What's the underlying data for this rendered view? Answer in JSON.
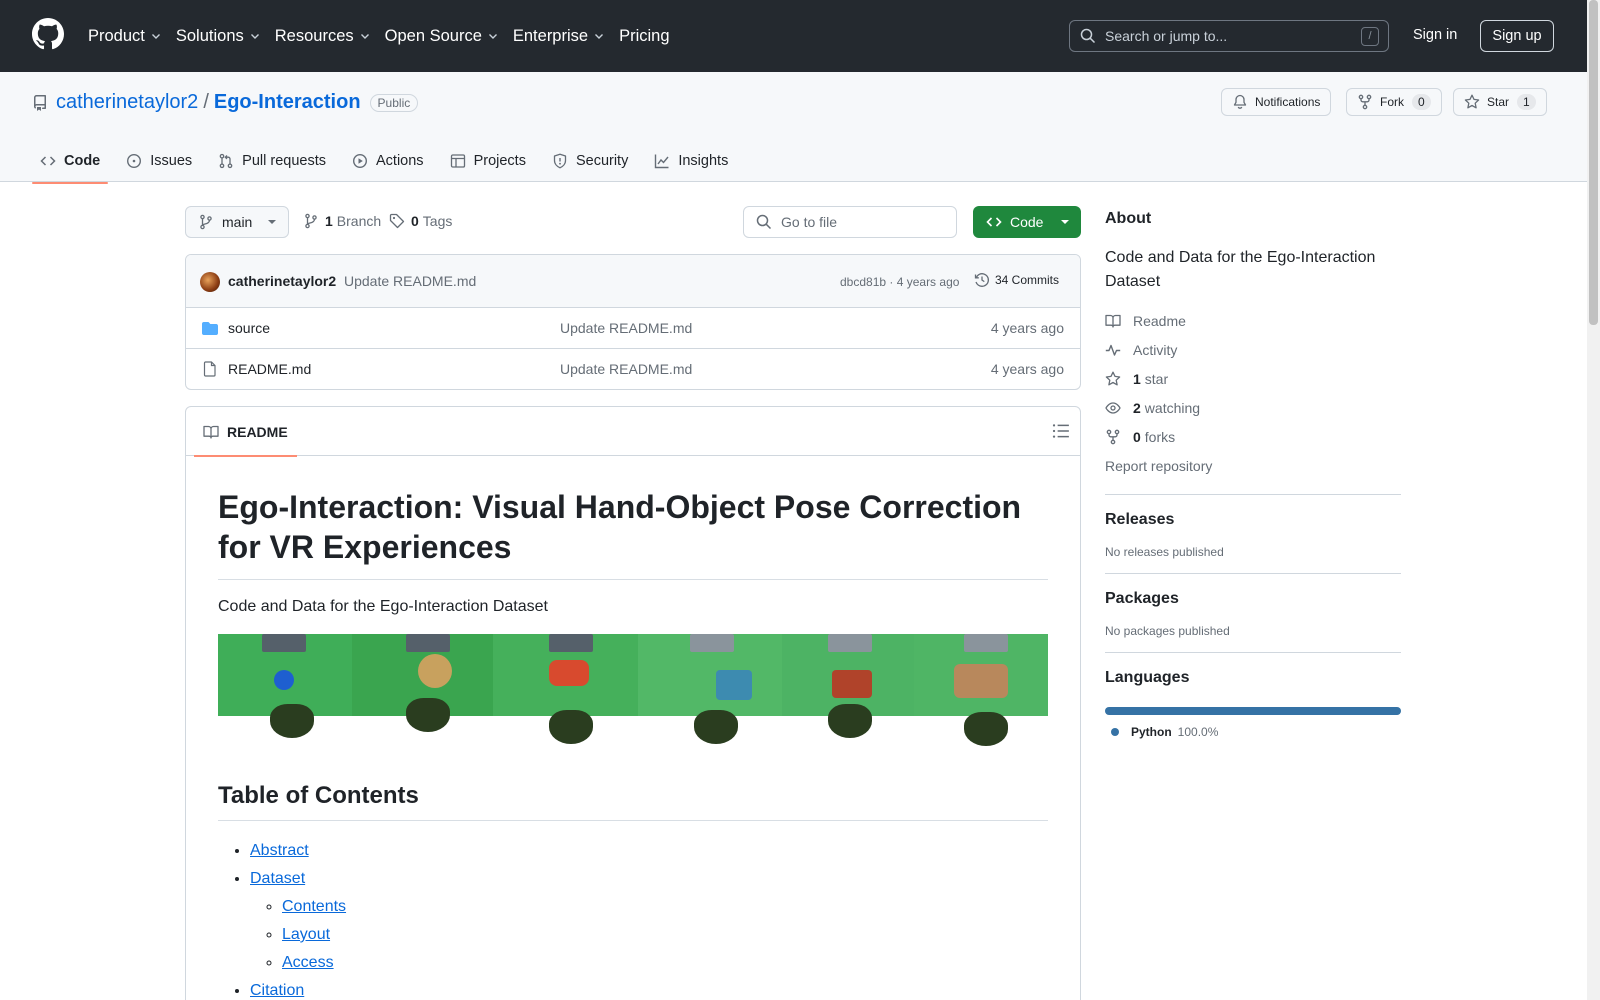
{
  "header": {
    "nav": [
      "Product",
      "Solutions",
      "Resources",
      "Open Source",
      "Enterprise",
      "Pricing"
    ],
    "search_placeholder": "Search or jump to...",
    "search_shortcut": "/",
    "sign_in": "Sign in",
    "sign_up": "Sign up"
  },
  "repo": {
    "owner": "catherinetaylor2",
    "separator": "/",
    "name": "Ego-Interaction",
    "visibility": "Public",
    "notifications_label": "Notifications",
    "fork_label": "Fork",
    "fork_count": "0",
    "star_label": "Star",
    "star_count": "1"
  },
  "tabs": [
    "Code",
    "Issues",
    "Pull requests",
    "Actions",
    "Projects",
    "Security",
    "Insights"
  ],
  "branch": {
    "name": "main",
    "branch_count": "1",
    "branch_label": "Branch",
    "tag_count": "0",
    "tag_label": "Tags",
    "goto_placeholder": "Go to file",
    "code_button": "Code"
  },
  "commit": {
    "author": "catherinetaylor2",
    "message": "Update README.md",
    "sha_age": "dbcd81b · 4 years ago",
    "commits_label": "34 Commits"
  },
  "files": [
    {
      "name": "source",
      "type": "folder",
      "message": "Update README.md",
      "age": "4 years ago"
    },
    {
      "name": "README.md",
      "type": "file",
      "message": "Update README.md",
      "age": "4 years ago"
    }
  ],
  "readme": {
    "tab_label": "README",
    "title": "Ego-Interaction: Visual Hand-Object Pose Correction for VR Experiences",
    "intro": "Code and Data for the Ego-Interaction Dataset",
    "toc_heading": "Table of Contents",
    "toc": {
      "abstract": "Abstract",
      "dataset": "Dataset",
      "contents": "Contents",
      "layout": "Layout",
      "access": "Access",
      "citation": "Citation"
    }
  },
  "about": {
    "heading": "About",
    "description": "Code and Data for the Ego-Interaction Dataset",
    "readme": "Readme",
    "activity": "Activity",
    "stars_count": "1",
    "stars_label": "star",
    "watching_count": "2",
    "watching_label": "watching",
    "forks_count": "0",
    "forks_label": "forks",
    "report": "Report repository"
  },
  "releases": {
    "heading": "Releases",
    "empty": "No releases published"
  },
  "packages": {
    "heading": "Packages",
    "empty": "No packages published"
  },
  "languages": {
    "heading": "Languages",
    "items": [
      {
        "name": "Python",
        "percent": "100.0%",
        "color": "#3572A5"
      }
    ]
  },
  "colors": {
    "accent": "#0969da",
    "primary_button": "#1f883d",
    "tab_underline": "#fd8c73",
    "header_bg": "#24292f"
  }
}
